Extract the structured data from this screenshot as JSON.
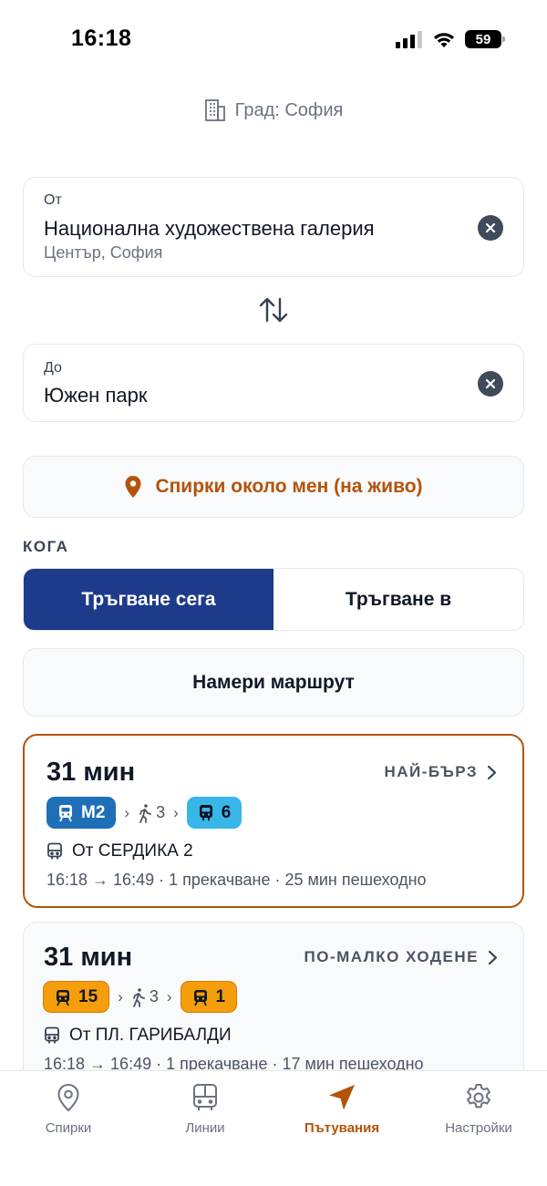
{
  "status_bar": {
    "time": "16:18",
    "battery": "59"
  },
  "city": {
    "icon": "building-icon",
    "label": "Град: София"
  },
  "from": {
    "label": "От",
    "value": "Национална художествена галерия",
    "sub": "Център, София"
  },
  "to": {
    "label": "До",
    "value": "Южен парк"
  },
  "nearby_button": {
    "label": "Спирки около мен (на живо)"
  },
  "when": {
    "label": "КОГА",
    "options": [
      "Тръгване сега",
      "Тръгване в"
    ],
    "selected": "Тръгване сега"
  },
  "find_button": {
    "label": "Намери маршрут"
  },
  "routes": [
    {
      "duration": "31 мин",
      "tag": "НАЙ-БЪРЗ",
      "legs": [
        {
          "type": "metro",
          "label": "M2",
          "color": "#1f6fb8"
        },
        {
          "type": "walk",
          "label": "3"
        },
        {
          "type": "bus",
          "label": "6",
          "color": "#38b6e8"
        }
      ],
      "stop": "От СЕРДИКА 2",
      "meta": "16:18 → 16:49 · 1 прекачване · 25 мин пешеходно"
    },
    {
      "duration": "31 мин",
      "tag": "ПО-МАЛКО ХОДЕНЕ",
      "legs": [
        {
          "type": "tram",
          "label": "15",
          "color": "#f59e0b"
        },
        {
          "type": "walk",
          "label": "3"
        },
        {
          "type": "tram",
          "label": "1",
          "color": "#f59e0b"
        }
      ],
      "stop": "От ПЛ. ГАРИБАЛДИ",
      "meta": "16:18 → 16:49 · 1 прекачване · 17 мин пешеходно"
    }
  ],
  "tabs": [
    {
      "label": "Спирки",
      "icon": "map-pin-icon"
    },
    {
      "label": "Линии",
      "icon": "bus-icon"
    },
    {
      "label": "Пътувания",
      "icon": "navigation-arrow-icon",
      "active": true
    },
    {
      "label": "Настройки",
      "icon": "gear-icon"
    }
  ],
  "colors": {
    "accent": "#b45309",
    "primary": "#1e3a8a"
  }
}
